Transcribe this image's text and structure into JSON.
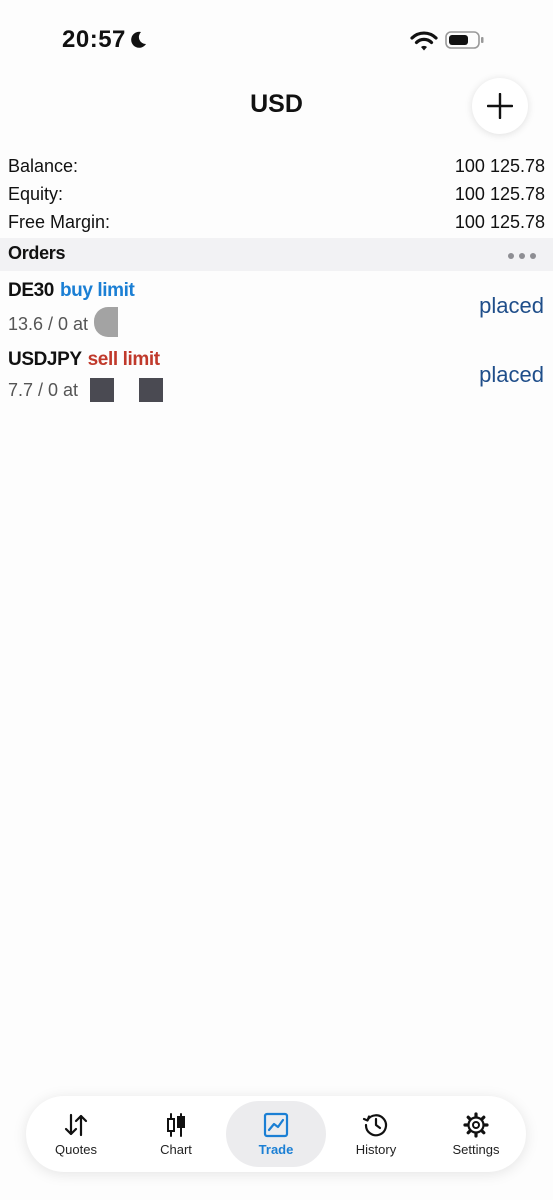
{
  "status_bar": {
    "time": "20:57"
  },
  "nav": {
    "title": "USD"
  },
  "summary": [
    {
      "label": "Balance:",
      "value": "100 125.78"
    },
    {
      "label": "Equity:",
      "value": "100 125.78"
    },
    {
      "label": "Free Margin:",
      "value": "100 125.78"
    }
  ],
  "orders_section": {
    "title": "Orders",
    "items": [
      {
        "symbol": "DE30",
        "type": "buy limit",
        "detail": "13.6 / 0 at",
        "status": "placed"
      },
      {
        "symbol": "USDJPY",
        "type": "sell limit",
        "detail": "7.7 / 0 at",
        "status": "placed"
      }
    ]
  },
  "tabs": [
    {
      "label": "Quotes",
      "icon": "quotes-arrows-icon"
    },
    {
      "label": "Chart",
      "icon": "candlestick-icon"
    },
    {
      "label": "Trade",
      "icon": "trade-chart-icon",
      "active": true
    },
    {
      "label": "History",
      "icon": "history-clock-icon"
    },
    {
      "label": "Settings",
      "icon": "gear-icon"
    }
  ],
  "colors": {
    "accent": "#1b7fd4",
    "sell": "#c0392b",
    "status": "#1f4e8a"
  }
}
